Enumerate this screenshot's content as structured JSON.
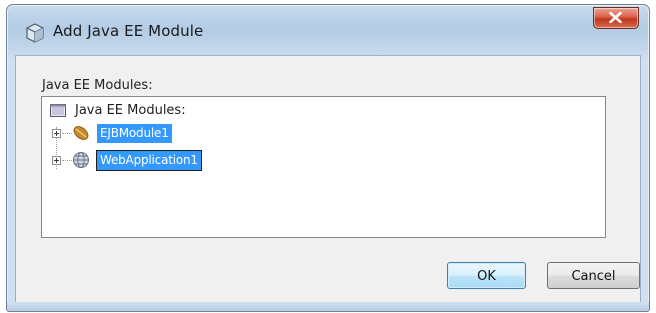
{
  "window": {
    "title": "Add Java EE Module"
  },
  "content": {
    "section_label": "Java EE Modules:",
    "tree": {
      "root_label": "Java EE Modules:",
      "nodes": [
        {
          "label": "EJBModule1",
          "icon": "bean-icon",
          "selected": true,
          "focused": false
        },
        {
          "label": "WebApplication1",
          "icon": "globe-icon",
          "selected": true,
          "focused": true
        }
      ]
    }
  },
  "buttons": {
    "ok_label": "OK",
    "cancel_label": "Cancel"
  },
  "colors": {
    "selection": "#3399ff",
    "close_button": "#c7402a",
    "default_button": "#a7d9f5"
  }
}
